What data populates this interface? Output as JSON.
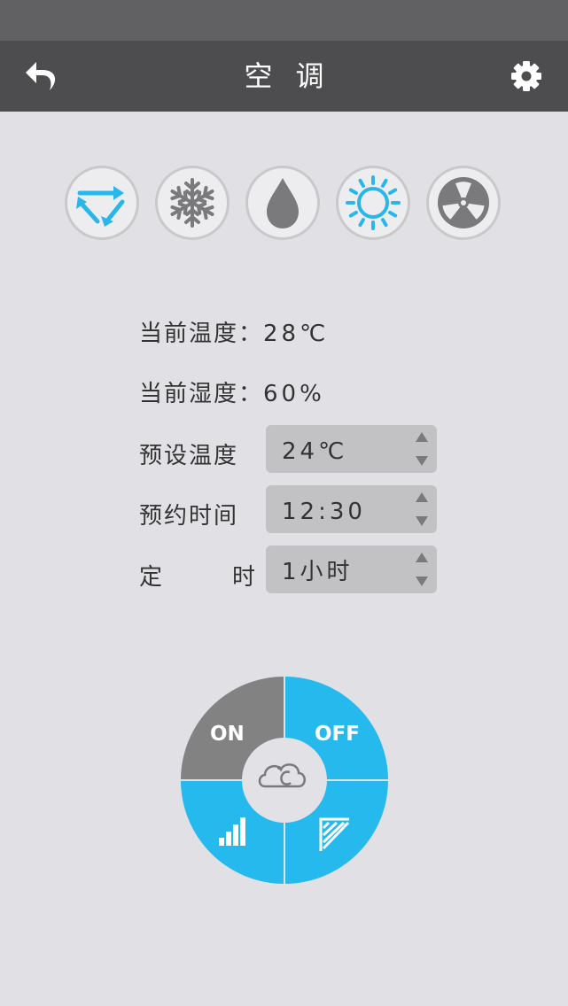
{
  "header": {
    "title": "空调",
    "icons": {
      "back": "back-arrow-icon",
      "settings": "gear-icon"
    }
  },
  "modes": [
    {
      "name": "mode-auto",
      "icon": "cycle-arrows-icon",
      "color": "#29b6ea"
    },
    {
      "name": "mode-cool",
      "icon": "snowflake-icon",
      "color": "#7a797c"
    },
    {
      "name": "mode-dry",
      "icon": "water-drop-icon",
      "color": "#7a797c"
    },
    {
      "name": "mode-heat",
      "icon": "sun-icon",
      "color": "#29b6ea"
    },
    {
      "name": "mode-fan",
      "icon": "fan-icon",
      "color": "#7a797c"
    }
  ],
  "status": {
    "temperature_label": "当前温度：",
    "temperature_value": "28℃",
    "humidity_label": "当前湿度：",
    "humidity_value": "60%"
  },
  "settings": {
    "preset_temp": {
      "label": "预设温度",
      "value": "24℃"
    },
    "schedule_time": {
      "label": "预约时间",
      "value": "12:30"
    },
    "timer": {
      "label_a": "定",
      "label_b": "时",
      "value": "1小时"
    }
  },
  "control": {
    "on_label": "ON",
    "off_label": "OFF",
    "center_icon": "cloud-celsius-icon",
    "speed_icon": "signal-bars-icon",
    "swing_icon": "swing-icon",
    "colors": {
      "on": "#828282",
      "active": "#25b9ee",
      "center": "#e2e1e6"
    }
  }
}
